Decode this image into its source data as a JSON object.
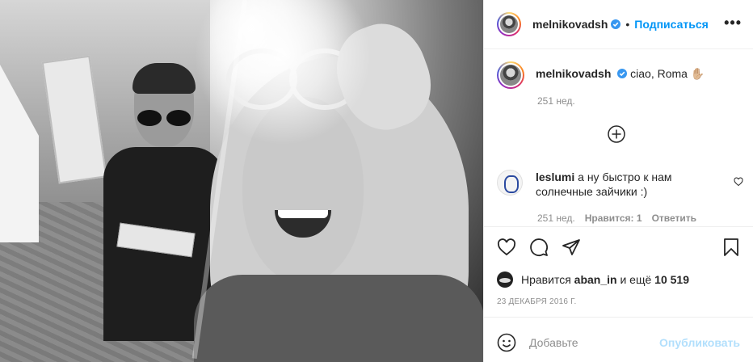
{
  "post": {
    "author": "melnikovadsh",
    "follow_label": "Подписаться",
    "dot": "•",
    "more": "•••"
  },
  "caption": {
    "username": "melnikovadsh",
    "text": "ciao, Roma",
    "emoji": "✋🏼",
    "time": "251 нед."
  },
  "comments": [
    {
      "username": "leslumi",
      "text": "а ну быстро к нам солнечные зайчики :)",
      "time": "251 нед.",
      "likes": "Нравится: 1",
      "reply": "Ответить"
    }
  ],
  "likes": {
    "prefix": "Нравится",
    "user": "aban_in",
    "middle": "и ещё",
    "count": "10 519"
  },
  "date": "23 ДЕКАБРЯ 2016 Г.",
  "add_comment": {
    "placeholder": "Добавьте",
    "publish": "Опубликовать"
  },
  "colors": {
    "accent": "#0095f6",
    "publish_disabled": "#b2dffc",
    "verified": "#3897f0",
    "muted": "#8e8e8e"
  }
}
